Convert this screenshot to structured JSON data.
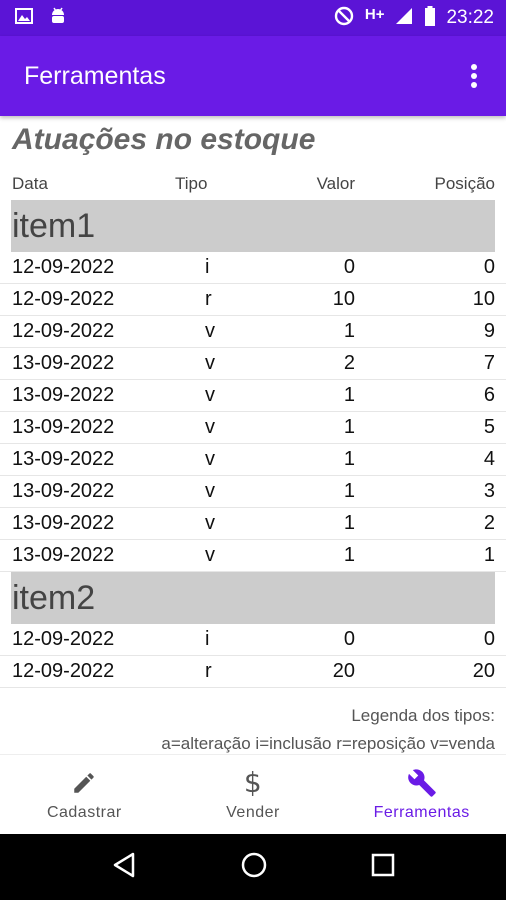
{
  "status_bar": {
    "time": "23:22",
    "network": "H+"
  },
  "app_bar": {
    "title": "Ferramentas",
    "menu_icon": "more-vert-icon"
  },
  "page": {
    "title": "Atuações no estoque",
    "columns": {
      "date": "Data",
      "type": "Tipo",
      "value": "Valor",
      "position": "Posição"
    }
  },
  "sections": [
    {
      "name": "item1",
      "rows": [
        {
          "date": "12-09-2022",
          "type": "i",
          "value": "0",
          "position": "0"
        },
        {
          "date": "12-09-2022",
          "type": "r",
          "value": "10",
          "position": "10"
        },
        {
          "date": "12-09-2022",
          "type": "v",
          "value": "1",
          "position": "9"
        },
        {
          "date": "13-09-2022",
          "type": "v",
          "value": "2",
          "position": "7"
        },
        {
          "date": "13-09-2022",
          "type": "v",
          "value": "1",
          "position": "6"
        },
        {
          "date": "13-09-2022",
          "type": "v",
          "value": "1",
          "position": "5"
        },
        {
          "date": "13-09-2022",
          "type": "v",
          "value": "1",
          "position": "4"
        },
        {
          "date": "13-09-2022",
          "type": "v",
          "value": "1",
          "position": "3"
        },
        {
          "date": "13-09-2022",
          "type": "v",
          "value": "1",
          "position": "2"
        },
        {
          "date": "13-09-2022",
          "type": "v",
          "value": "1",
          "position": "1"
        }
      ]
    },
    {
      "name": "item2",
      "rows": [
        {
          "date": "12-09-2022",
          "type": "i",
          "value": "0",
          "position": "0"
        },
        {
          "date": "12-09-2022",
          "type": "r",
          "value": "20",
          "position": "20"
        }
      ]
    }
  ],
  "legend": {
    "title": "Legenda dos tipos:",
    "text": "a=alteração i=inclusão r=reposição v=venda"
  },
  "bottom_nav": [
    {
      "label": "Cadastrar",
      "icon": "pencil-icon",
      "active": false
    },
    {
      "label": "Vender",
      "icon": "dollar-icon",
      "active": false
    },
    {
      "label": "Ferramentas",
      "icon": "wrench-icon",
      "active": true
    }
  ],
  "colors": {
    "primary": "#6a1be6",
    "status_bar": "#5b14d6",
    "section_bg": "#cccccc"
  }
}
